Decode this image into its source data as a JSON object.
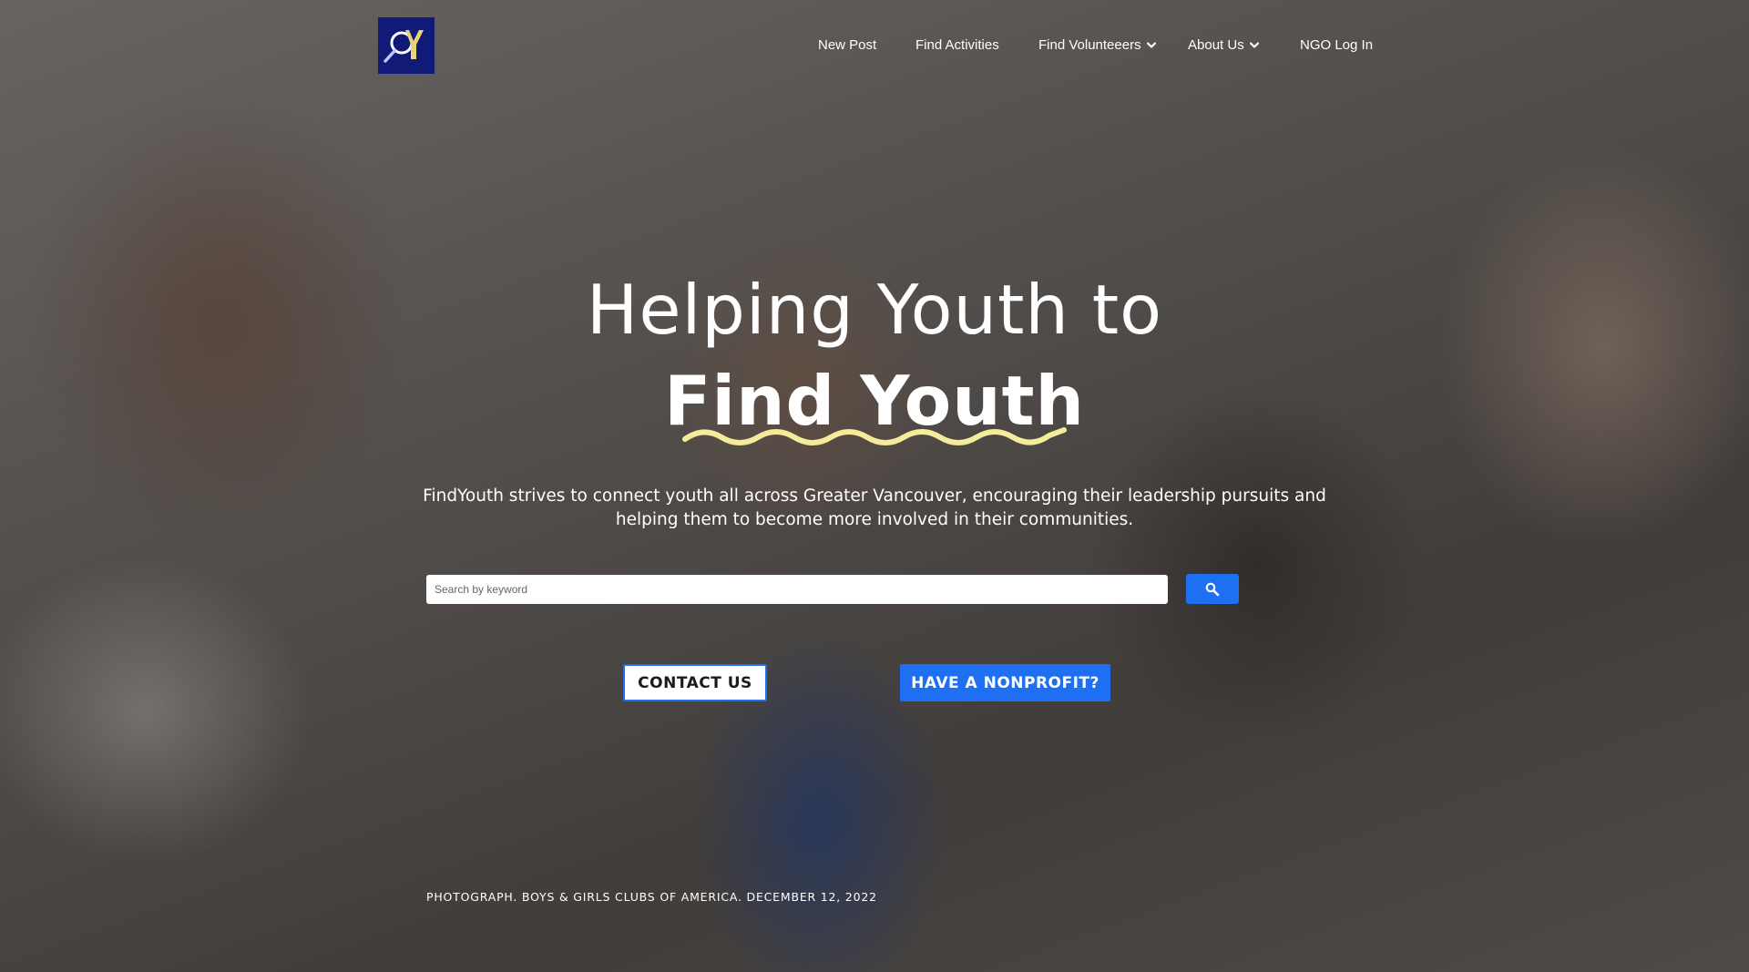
{
  "brand": {
    "logo_icon": "findyouth-logo-icon",
    "logo_bg": "#121a78",
    "logo_accent": "#e8d27a"
  },
  "nav": {
    "new_post": "New Post",
    "find_activities": "Find Activities",
    "find_volunteers": "Find Volunteeers",
    "about_us": "About Us",
    "ngo_login": "NGO Log In",
    "dropdown_icon": "chevron-down-icon"
  },
  "hero": {
    "background": "photo-kids-high-five",
    "headline_line1": "Helping Youth to",
    "headline_line2": "Find Youth",
    "underline_color": "#f4ec9a",
    "description": "FindYouth strives to connect youth all across Greater Vancouver, encouraging their leadership pursuits and helping them to become more involved in their communities.",
    "search": {
      "placeholder": "Search by keyword",
      "value": "",
      "button_icon": "search-icon"
    },
    "contact_button": "CONTACT US",
    "nonprofit_button": "HAVE A NONPROFIT?",
    "photo_credit": "PHOTOGRAPH. BOYS & GIRLS CLUBS OF AMERICA. DECEMBER 12, 2022"
  },
  "colors": {
    "accent": "#1e6ff2",
    "text": "#ffffff"
  }
}
